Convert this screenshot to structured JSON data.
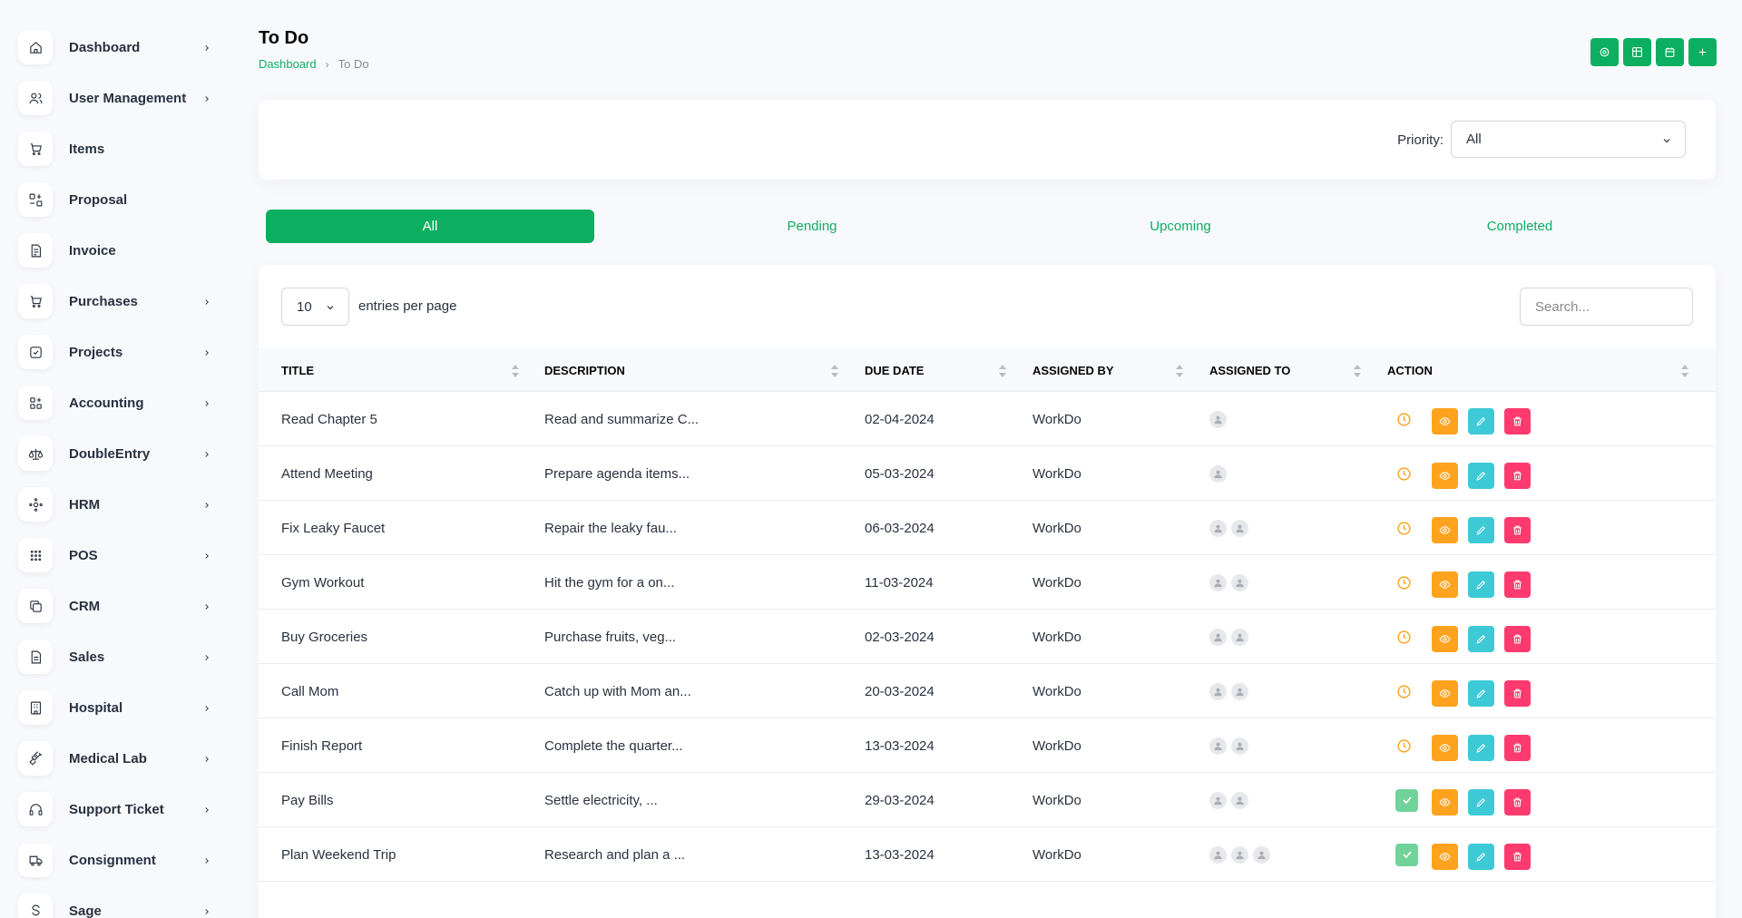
{
  "sidebar": {
    "items": [
      {
        "label": "Dashboard",
        "icon": "home-icon",
        "has_submenu": true
      },
      {
        "label": "User Management",
        "icon": "users-icon",
        "has_submenu": true
      },
      {
        "label": "Items",
        "icon": "cart-icon",
        "has_submenu": false
      },
      {
        "label": "Proposal",
        "icon": "proposal-icon",
        "has_submenu": false
      },
      {
        "label": "Invoice",
        "icon": "invoice-icon",
        "has_submenu": false
      },
      {
        "label": "Purchases",
        "icon": "cart-icon",
        "has_submenu": true
      },
      {
        "label": "Projects",
        "icon": "checkbox-icon",
        "has_submenu": true
      },
      {
        "label": "Accounting",
        "icon": "apps-icon",
        "has_submenu": true
      },
      {
        "label": "DoubleEntry",
        "icon": "scale-icon",
        "has_submenu": true
      },
      {
        "label": "HRM",
        "icon": "hrm-icon",
        "has_submenu": true
      },
      {
        "label": "POS",
        "icon": "grid-dots-icon",
        "has_submenu": true
      },
      {
        "label": "CRM",
        "icon": "layers-icon",
        "has_submenu": true
      },
      {
        "label": "Sales",
        "icon": "file-icon",
        "has_submenu": true
      },
      {
        "label": "Hospital",
        "icon": "building-icon",
        "has_submenu": true
      },
      {
        "label": "Medical Lab",
        "icon": "vaccine-icon",
        "has_submenu": true
      },
      {
        "label": "Support Ticket",
        "icon": "headset-icon",
        "has_submenu": true
      },
      {
        "label": "Consignment",
        "icon": "truck-icon",
        "has_submenu": true
      },
      {
        "label": "Sage",
        "icon": "sage-icon",
        "has_submenu": true
      }
    ]
  },
  "header": {
    "title": "To Do",
    "breadcrumb": {
      "home": "Dashboard",
      "separator": "›",
      "current": "To Do"
    },
    "actions": [
      "settings-icon",
      "table-icon",
      "calendar-icon",
      "plus-icon"
    ]
  },
  "filter": {
    "priority_label": "Priority:",
    "priority_value": "All"
  },
  "tabs": [
    {
      "label": "All",
      "active": true
    },
    {
      "label": "Pending",
      "active": false
    },
    {
      "label": "Upcoming",
      "active": false
    },
    {
      "label": "Completed",
      "active": false
    }
  ],
  "table": {
    "entries_value": "10",
    "entries_label": "entries per page",
    "search_placeholder": "Search...",
    "columns": [
      "Title",
      "Description",
      "Due Date",
      "Assigned By",
      "Assigned To",
      "Action"
    ],
    "rows": [
      {
        "title": "Read Chapter 5",
        "description": "Read and summarize C...",
        "due": "02-04-2024",
        "by": "WorkDo",
        "assignees": 1,
        "status": "pending"
      },
      {
        "title": "Attend Meeting",
        "description": "Prepare agenda items...",
        "due": "05-03-2024",
        "by": "WorkDo",
        "assignees": 1,
        "status": "pending"
      },
      {
        "title": "Fix Leaky Faucet",
        "description": "Repair the leaky fau...",
        "due": "06-03-2024",
        "by": "WorkDo",
        "assignees": 2,
        "status": "pending"
      },
      {
        "title": "Gym Workout",
        "description": "Hit the gym for a on...",
        "due": "11-03-2024",
        "by": "WorkDo",
        "assignees": 2,
        "status": "pending"
      },
      {
        "title": "Buy Groceries",
        "description": "Purchase fruits, veg...",
        "due": "02-03-2024",
        "by": "WorkDo",
        "assignees": 2,
        "status": "pending"
      },
      {
        "title": "Call Mom",
        "description": "Catch up with Mom an...",
        "due": "20-03-2024",
        "by": "WorkDo",
        "assignees": 2,
        "status": "pending"
      },
      {
        "title": "Finish Report",
        "description": "Complete the quarter...",
        "due": "13-03-2024",
        "by": "WorkDo",
        "assignees": 2,
        "status": "pending"
      },
      {
        "title": "Pay Bills",
        "description": "Settle electricity, ...",
        "due": "29-03-2024",
        "by": "WorkDo",
        "assignees": 2,
        "status": "completed"
      },
      {
        "title": "Plan Weekend Trip",
        "description": "Research and plan a ...",
        "due": "13-03-2024",
        "by": "WorkDo",
        "assignees": 3,
        "status": "completed"
      }
    ]
  },
  "colors": {
    "primary": "#0caf60",
    "view": "#ffa21d",
    "edit": "#3ec9d6",
    "delete": "#ff3a6e",
    "pending": "#ffa21d",
    "done": "#6fd39a"
  }
}
